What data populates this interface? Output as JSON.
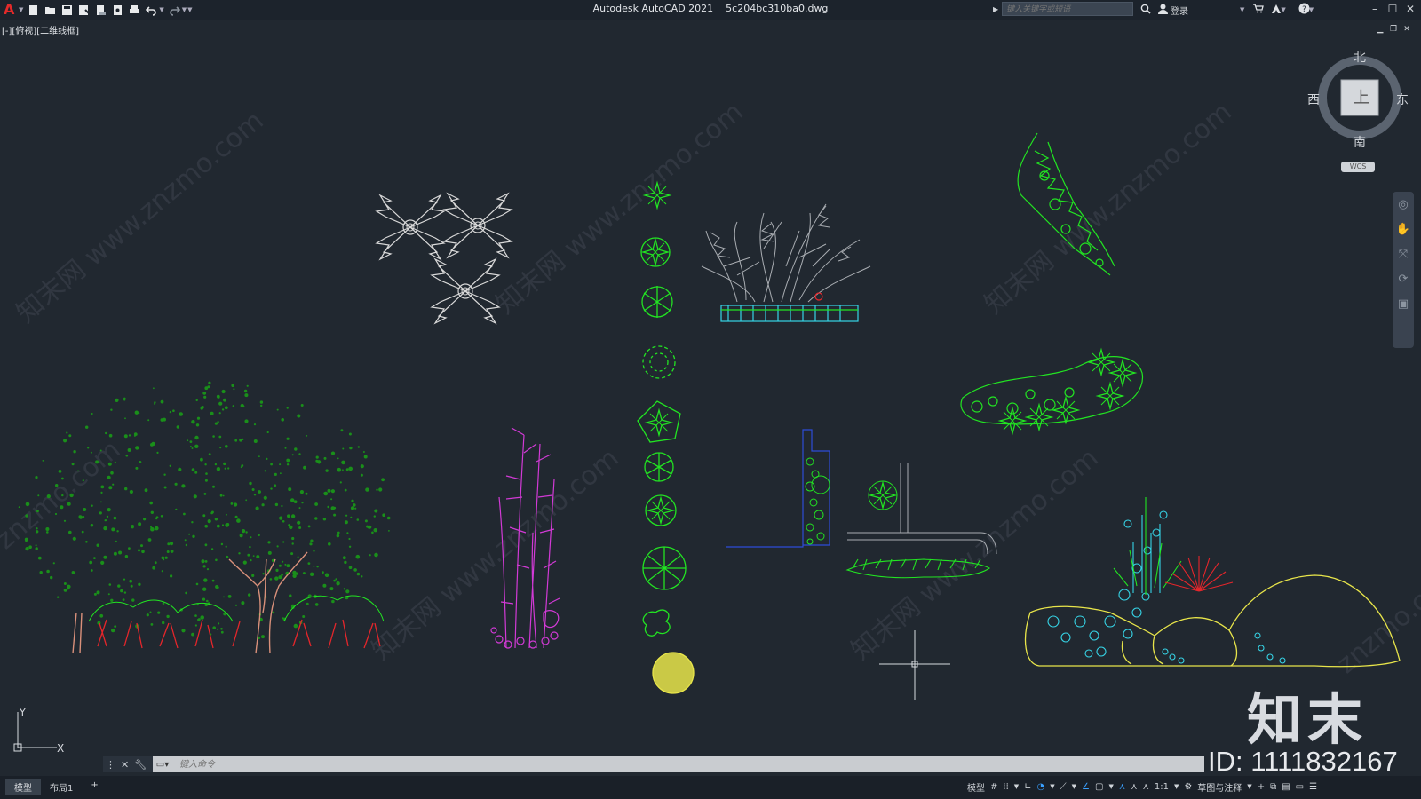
{
  "app": {
    "title": "Autodesk AutoCAD 2021",
    "filename": "5c204bc310ba0.dwg",
    "logo": "A"
  },
  "search": {
    "placeholder": "键入关键字或短语"
  },
  "account": {
    "login_label": "登录"
  },
  "viewport": {
    "label": "[-][俯视][二维线框]"
  },
  "viewcube": {
    "north": "北",
    "south": "南",
    "east": "东",
    "west": "西",
    "top_face": "上",
    "wcs": "WCS"
  },
  "ucs": {
    "x_label": "X",
    "y_label": "Y"
  },
  "command": {
    "placeholder": "键入命令"
  },
  "layout_tabs": [
    {
      "label": "模型"
    },
    {
      "label": "布局1"
    },
    {
      "label": "+"
    }
  ],
  "status": {
    "model_label": "模型",
    "scale": "1:1",
    "workspace": "草图与注释"
  },
  "watermark": {
    "logo": "知末",
    "id_text": "ID: 1111832167",
    "site": "知末网 www.znzmo.com",
    "site_short": "znzmo.com"
  },
  "colors": {
    "background": "#212830",
    "green": "#22e422",
    "dark_green": "#1a8f1a",
    "magenta": "#d23ad6",
    "yellow": "#e8e54a",
    "cyan": "#36d4e6",
    "red": "#e5262b",
    "white": "#d8d8d8",
    "blue": "#2d4cd8",
    "brown": "#d9907a"
  }
}
